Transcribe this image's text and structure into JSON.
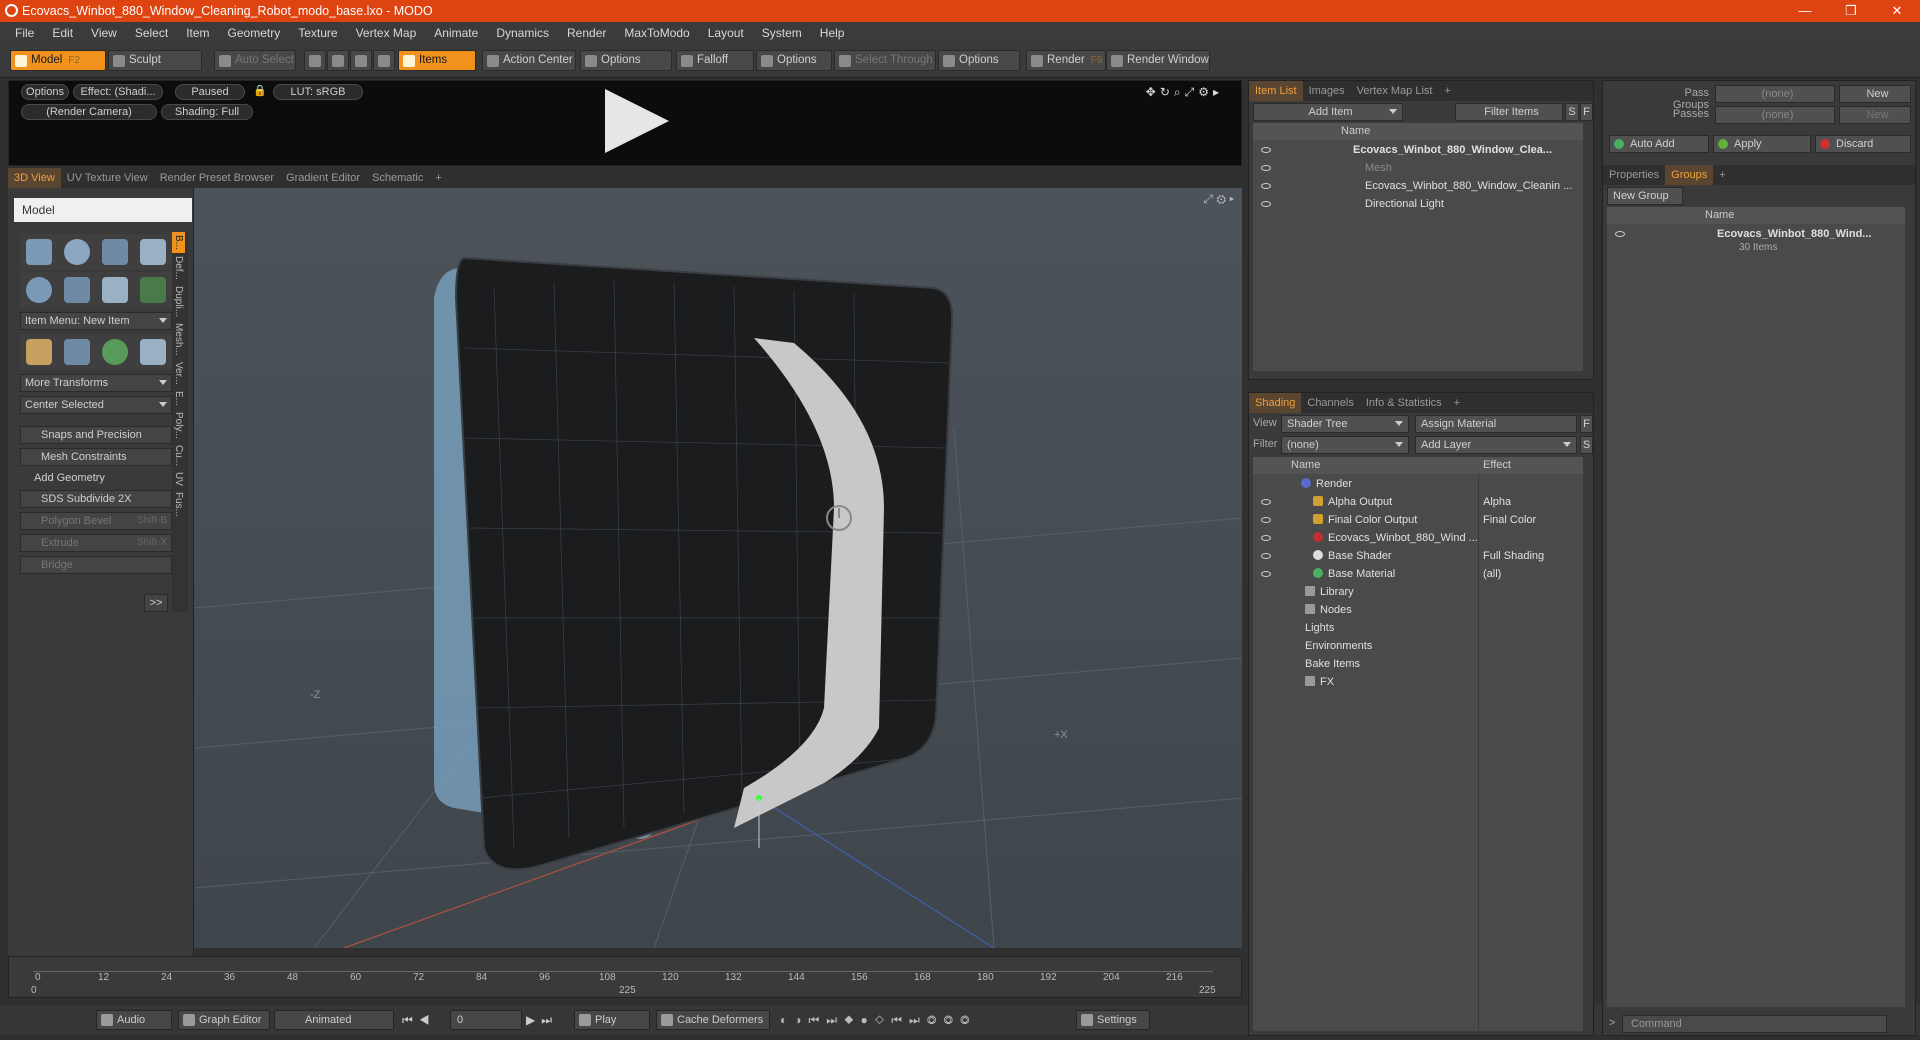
{
  "window": {
    "title": "Ecovacs_Winbot_880_Window_Cleaning_Robot_modo_base.lxo - MODO",
    "min": "—",
    "max": "❐",
    "close": "✕"
  },
  "menu": [
    "File",
    "Edit",
    "View",
    "Select",
    "Item",
    "Geometry",
    "Texture",
    "Vertex Map",
    "Animate",
    "Dynamics",
    "Render",
    "MaxToModo",
    "Layout",
    "System",
    "Help"
  ],
  "toolbar": {
    "model": "Model",
    "model_key": "F2",
    "sculpt": "Sculpt",
    "auto_select": "Auto Select",
    "items": "Items",
    "action_center": "Action Center",
    "options1": "Options",
    "falloff": "Falloff",
    "options2": "Options",
    "select_through": "Select Through",
    "options3": "Options",
    "render": "Render",
    "render_key": "F9",
    "render_window": "Render Window"
  },
  "preview": {
    "options": "Options",
    "effect": "Effect: (Shadi...",
    "paused": "Paused",
    "lut": "LUT: sRGB",
    "camera": "(Render Camera)",
    "shading": "Shading: Full"
  },
  "viewtabs": [
    "3D View",
    "UV Texture View",
    "Render Preset Browser",
    "Gradient Editor",
    "Schematic",
    "+"
  ],
  "left": {
    "header": "Model",
    "item_menu": "Item Menu: New Item",
    "more_transforms": "More Transforms",
    "center_selected": "Center Selected",
    "snaps": "Snaps and Precision",
    "mesh_constraints": "Mesh Constraints",
    "add_geometry": "Add Geometry",
    "sds": "SDS Subdivide 2X",
    "polygon_bevel": "Polygon Bevel",
    "polygon_bevel_key": "Shift-B",
    "extrude": "Extrude",
    "extrude_key": "Shift-X",
    "bridge": "Bridge",
    "more": ">>",
    "vtabs": [
      "B...",
      "Def...",
      "Dupli...",
      "Mesh...",
      "Ver...",
      "E...",
      "Poly...",
      "Cu...",
      "UV",
      "Fus..."
    ]
  },
  "viewport": {
    "axis_z": "-Z",
    "axis_x": "+X"
  },
  "timeline": {
    "ticks": [
      "0",
      "12",
      "24",
      "36",
      "48",
      "60",
      "72",
      "84",
      "96",
      "108",
      "120",
      "132",
      "144",
      "156",
      "168",
      "180",
      "192",
      "204",
      "216"
    ],
    "start": "0",
    "mid": "225",
    "end": "225"
  },
  "bottom": {
    "audio": "Audio",
    "graph_editor": "Graph Editor",
    "animated": "Animated",
    "frame": "0",
    "play": "Play",
    "cache": "Cache Deformers",
    "settings": "Settings"
  },
  "itemlist": {
    "tabs": [
      "Item List",
      "Images",
      "Vertex Map List",
      "+"
    ],
    "add_item": "Add Item",
    "filter_items": "Filter Items",
    "s": "S",
    "f": "F",
    "col_name": "Name",
    "rows": [
      "Ecovacs_Winbot_880_Window_Clea...",
      "Mesh",
      "Ecovacs_Winbot_880_Window_Cleanin ...",
      "Directional Light"
    ]
  },
  "shading": {
    "tabs": [
      "Shading",
      "Channels",
      "Info & Statistics",
      "+"
    ],
    "view_label": "View",
    "view_value": "Shader Tree",
    "assign_material": "Assign Material",
    "f": "F",
    "filter_label": "Filter",
    "filter_value": "(none)",
    "add_layer": "Add Layer",
    "s": "S",
    "col_name": "Name",
    "col_effect": "Effect",
    "rows": [
      {
        "name": "Render",
        "effect": ""
      },
      {
        "name": "Alpha Output",
        "effect": "Alpha"
      },
      {
        "name": "Final Color Output",
        "effect": "Final Color"
      },
      {
        "name": "Ecovacs_Winbot_880_Wind ...",
        "effect": ""
      },
      {
        "name": "Base Shader",
        "effect": "Full Shading"
      },
      {
        "name": "Base Material",
        "effect": "(all)"
      },
      {
        "name": "Library",
        "effect": ""
      },
      {
        "name": "Nodes",
        "effect": ""
      },
      {
        "name": "Lights",
        "effect": ""
      },
      {
        "name": "Environments",
        "effect": ""
      },
      {
        "name": "Bake Items",
        "effect": ""
      },
      {
        "name": "FX",
        "effect": ""
      }
    ]
  },
  "right": {
    "pass_groups": "Pass Groups",
    "pass_groups_val": "(none)",
    "new1": "New",
    "passes": "Passes",
    "passes_val": "(none)",
    "new2": "New",
    "auto_add": "Auto Add",
    "apply": "Apply",
    "discard": "Discard",
    "tabs": [
      "Properties",
      "Groups",
      "+"
    ],
    "new_group": "New Group",
    "col_name": "Name",
    "group_name": "Ecovacs_Winbot_880_Wind...",
    "group_count": "30 Items",
    "command": "Command"
  }
}
